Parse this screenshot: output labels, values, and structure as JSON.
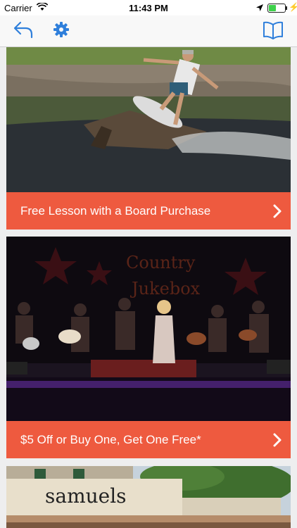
{
  "status_bar": {
    "carrier": "Carrier",
    "time": "11:43 PM"
  },
  "nav": {
    "back_icon": "back-arrow-icon",
    "settings_icon": "gear-icon",
    "bookmarks_icon": "open-book-icon",
    "accent_color": "#2f7fdb"
  },
  "cards": [
    {
      "banner": "Free Lesson with a Board Purchase",
      "image": "skimboarder jumping off wooden ramp into water"
    },
    {
      "banner": "$5 Off or Buy One, Get One Free*",
      "image": "band performing on stage under Country Jukebox sign"
    },
    {
      "banner": "",
      "image": "storefront with samuels sign",
      "sign_text": "samuels"
    }
  ],
  "banner_color": "#ee5a3f"
}
